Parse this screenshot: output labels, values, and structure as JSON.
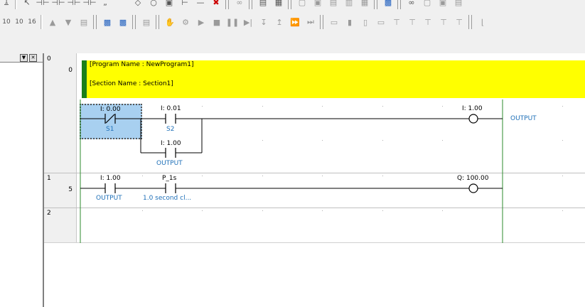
{
  "toolbar": {
    "row1_labels": [
      "1"
    ],
    "row2_labels": [
      "10",
      "10",
      "16"
    ]
  },
  "program": {
    "program_name_line": "[Program Name : NewProgram1]",
    "section_name_line": "[Section Name : Section1]"
  },
  "rungs": [
    {
      "rung_no": "0",
      "step_no": "0",
      "contacts": [
        {
          "address": "I: 0.00",
          "comment": "S1",
          "type": "nc",
          "selected": true
        },
        {
          "address": "I: 0.01",
          "comment": "S2",
          "type": "no"
        },
        {
          "address": "I: 1.00",
          "comment": "OUTPUT",
          "type": "no",
          "branch": true
        }
      ],
      "coil": {
        "address": "I: 1.00",
        "comment": "OUTPUT"
      }
    },
    {
      "rung_no": "1",
      "step_no": "5",
      "contacts": [
        {
          "address": "I: 1.00",
          "comment": "OUTPUT",
          "type": "no"
        },
        {
          "address": "P_1s",
          "comment": "1.0 second cl...",
          "type": "no"
        }
      ],
      "coil": {
        "address": "Q: 100.00",
        "comment": ""
      }
    },
    {
      "rung_no": "2",
      "step_no": ""
    }
  ],
  "colors": {
    "comment_bg": "#ffff00",
    "comment_bar": "#1a7f1a",
    "rail": "#2e8b2e",
    "comment_text": "#1f70b8",
    "selection": "#a8d0f0"
  }
}
